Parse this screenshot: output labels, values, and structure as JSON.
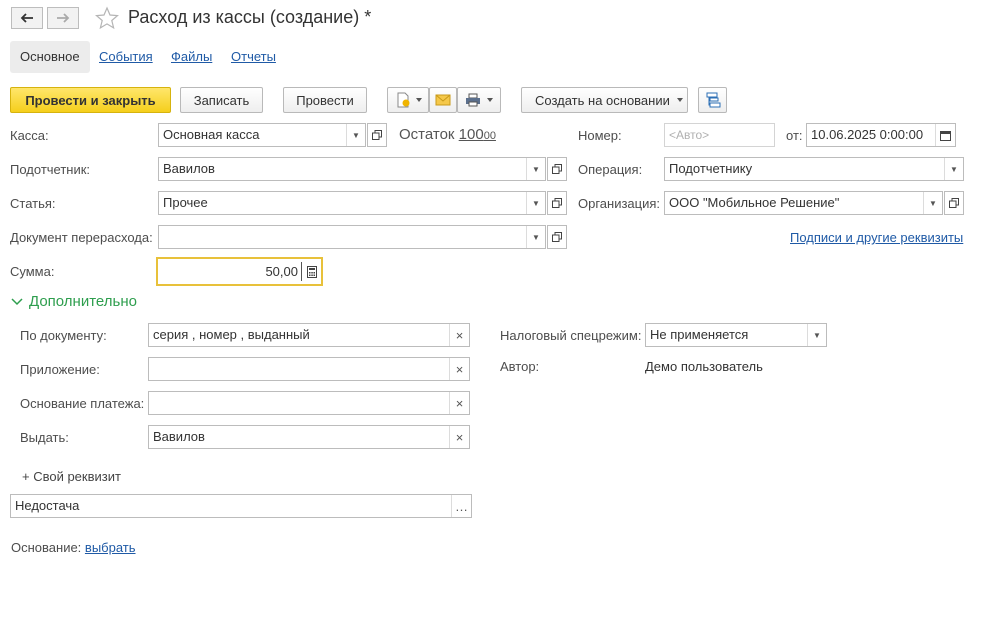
{
  "window": {
    "title": "Расход из кассы (создание) *"
  },
  "tabs": [
    {
      "label": "Основное"
    },
    {
      "label": "События"
    },
    {
      "label": "Файлы"
    },
    {
      "label": "Отчеты"
    }
  ],
  "toolbar": {
    "post_close_label": "Провести и закрыть",
    "save_label": "Записать",
    "post_label": "Провести",
    "create_based_label": "Создать на основании"
  },
  "form": {
    "kassa": {
      "label": "Касса:",
      "value": "Основная касса"
    },
    "balance": {
      "label": "Остаток",
      "value": "100",
      "cents": "00"
    },
    "number": {
      "label": "Номер:",
      "placeholder": "<Авто>"
    },
    "date": {
      "label": "от:",
      "value": "10.06.2025  0:00:00"
    },
    "accountable": {
      "label": "Подотчетник:",
      "value": "Вавилов"
    },
    "operation": {
      "label": "Операция:",
      "value": "Подотчетнику"
    },
    "article": {
      "label": "Статья:",
      "value": "Прочее"
    },
    "organization": {
      "label": "Организация:",
      "value": "ООО \"Мобильное Решение\""
    },
    "overspend_doc": {
      "label": "Документ перерасхода:",
      "value": ""
    },
    "signatures_link": "Подписи и другие реквизиты",
    "sum": {
      "label": "Сумма:",
      "value": "50,00"
    }
  },
  "additional": {
    "header": "Дополнительно",
    "by_document": {
      "label": "По документу:",
      "value": "серия , номер , выданный"
    },
    "attachment": {
      "label": "Приложение:",
      "value": ""
    },
    "payment_basis": {
      "label": "Основание платежа:",
      "value": ""
    },
    "issue_to": {
      "label": "Выдать:",
      "value": "Вавилов"
    },
    "tax_regime": {
      "label": "Налоговый спецрежим:",
      "value": "Не применяется"
    },
    "author": {
      "label": "Автор:",
      "value": "Демо пользователь"
    }
  },
  "custom_attr": {
    "add_label": "+ Свой реквизит",
    "value": "Недостача"
  },
  "basis": {
    "label": "Основание:",
    "link": "выбрать"
  },
  "colors": {
    "accent_yellow": "#f5cf1c",
    "link_blue": "#1f5aa6",
    "section_green": "#2e9e4e",
    "sum_border": "#e8c13a"
  }
}
